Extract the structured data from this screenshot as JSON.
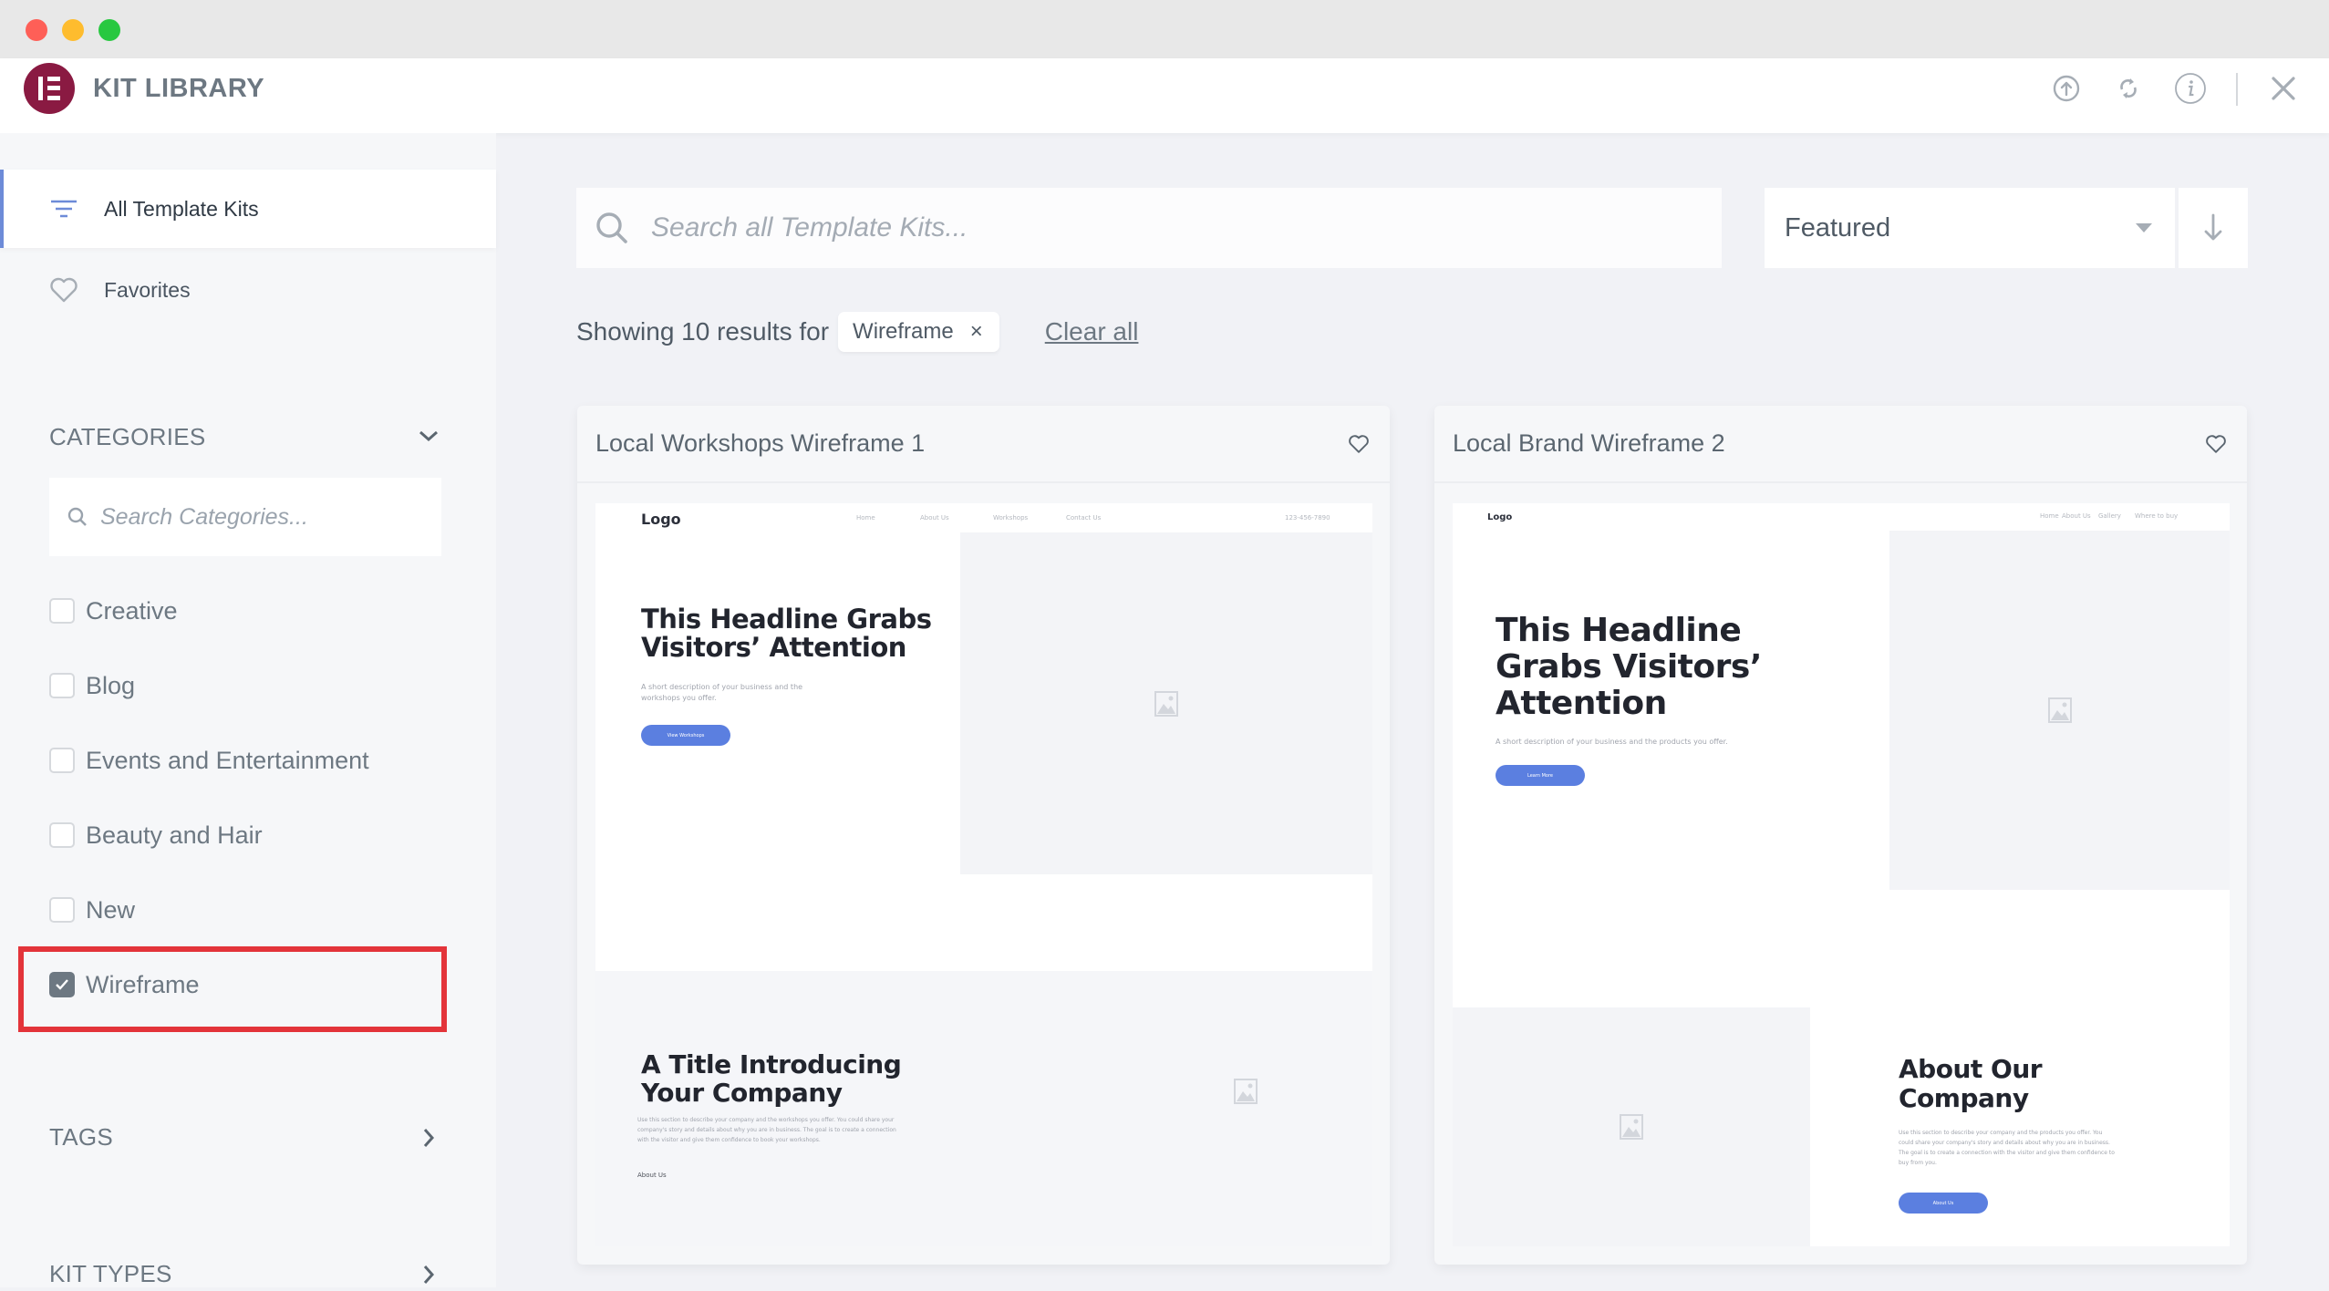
{
  "window": {
    "traffic_lights": [
      {
        "name": "close",
        "color": "#fe5f57"
      },
      {
        "name": "minimize",
        "color": "#febc2e"
      },
      {
        "name": "zoom",
        "color": "#28c840"
      }
    ]
  },
  "header": {
    "title": "KIT LIBRARY",
    "brand_color": "#8a1a42",
    "actions": [
      {
        "name": "import-kit",
        "icon": "upload-circle-icon"
      },
      {
        "name": "sync",
        "icon": "refresh-icon"
      },
      {
        "name": "info",
        "icon": "info-icon"
      },
      {
        "name": "close",
        "icon": "close-icon"
      }
    ]
  },
  "sidebar": {
    "nav": [
      {
        "label": "All Template Kits",
        "icon": "filter-lines-icon",
        "active": true
      },
      {
        "label": "Favorites",
        "icon": "heart-icon",
        "active": false
      }
    ],
    "categories": {
      "title": "CATEGORIES",
      "search_placeholder": "Search Categories...",
      "items": [
        {
          "label": "Creative",
          "checked": false
        },
        {
          "label": "Blog",
          "checked": false
        },
        {
          "label": "Events and Entertainment",
          "checked": false
        },
        {
          "label": "Beauty and Hair",
          "checked": false
        },
        {
          "label": "New",
          "checked": false
        },
        {
          "label": "Wireframe",
          "checked": true
        }
      ]
    },
    "tags": {
      "title": "TAGS"
    },
    "kit_types": {
      "title": "KIT TYPES"
    }
  },
  "main": {
    "search_placeholder": "Search all Template Kits...",
    "sort": {
      "selected": "Featured",
      "direction": "descending"
    },
    "results": {
      "text": "Showing 10 results for",
      "filter_chip": "Wireframe",
      "chip_remove": "×",
      "clear_all": "Clear all"
    },
    "accent_color": "#5b7fe0",
    "cards": [
      {
        "title": "Local Workshops Wireframe 1",
        "preview": {
          "logo": "Logo",
          "nav": [
            "Home",
            "About Us",
            "Workshops",
            "Contact Us"
          ],
          "phone": "123-456-7890",
          "headline": "This Headline Grabs Visitors’ Attention",
          "description": "A short description of your business and the workshops you offer.",
          "button": "View Workshops",
          "section_title": "A Title Introducing Your Company",
          "section_text": "Use this section to describe your company and the workshops you offer. You could share your company's story and details about why you are in business. The goal is to create a connection with the visitor and give them confidence to book your workshops.",
          "section_link": "About Us"
        }
      },
      {
        "title": "Local Brand Wireframe 2",
        "preview": {
          "logo": "Logo",
          "nav": [
            "Home",
            "About Us",
            "Gallery",
            "Where to buy"
          ],
          "headline": "This Headline Grabs Visitors’ Attention",
          "description": "A short description of your business and the products you offer.",
          "button": "Learn More",
          "section_title": "About Our Company",
          "section_text": "Use this section to describe your company and the products you offer. You could share your company's story and details about why you are in business. The goal is to create a connection with the visitor and give them confidence to buy from you.",
          "section_button": "About Us"
        }
      }
    ]
  }
}
